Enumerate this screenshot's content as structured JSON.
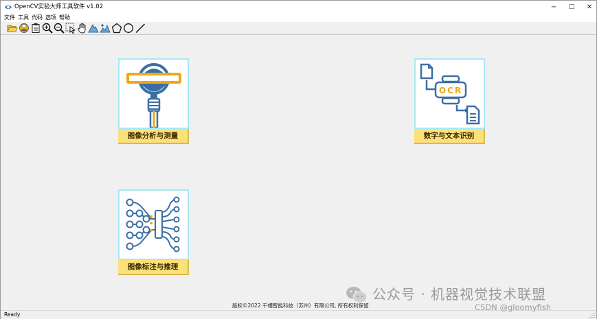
{
  "window": {
    "title": "OpenCV实验大师工具软件 v1.02"
  },
  "window_controls": {
    "minimize": "−",
    "maximize": "□",
    "close": "✕"
  },
  "menu": [
    "文件",
    "工具",
    "代码",
    "选项",
    "帮助"
  ],
  "toolbar": [
    "open-folder-icon",
    "save-icon",
    "clipboard-icon",
    "zoom-in-icon",
    "zoom-out-icon",
    "select-pointer-icon",
    "pan-hand-icon",
    "triangle-tool-icon",
    "mountain-tool-icon",
    "polygon-icon",
    "circle-icon",
    "line-icon"
  ],
  "cards": [
    {
      "label": "图像分析与测量",
      "icon": "magnifier-icon"
    },
    {
      "label": "数字与文本识别",
      "icon": "ocr-icon"
    },
    {
      "label": "图像标注与推理",
      "icon": "neural-network-icon"
    }
  ],
  "ocr_text": "OCR",
  "footer": {
    "copyright": "版权©2022 千幢智能科技（苏州）有限公司, 所有权利保留"
  },
  "status": {
    "text": "Ready"
  },
  "watermark": {
    "text": "公众号 · 机器视觉技术联盟",
    "csdn": "CSDN @gloomyfish"
  },
  "colors": {
    "accent_blue": "#3b6ea5",
    "accent_orange": "#f0a818",
    "label_yellow": "#fce07a",
    "card_border": "#a8e8f6"
  }
}
